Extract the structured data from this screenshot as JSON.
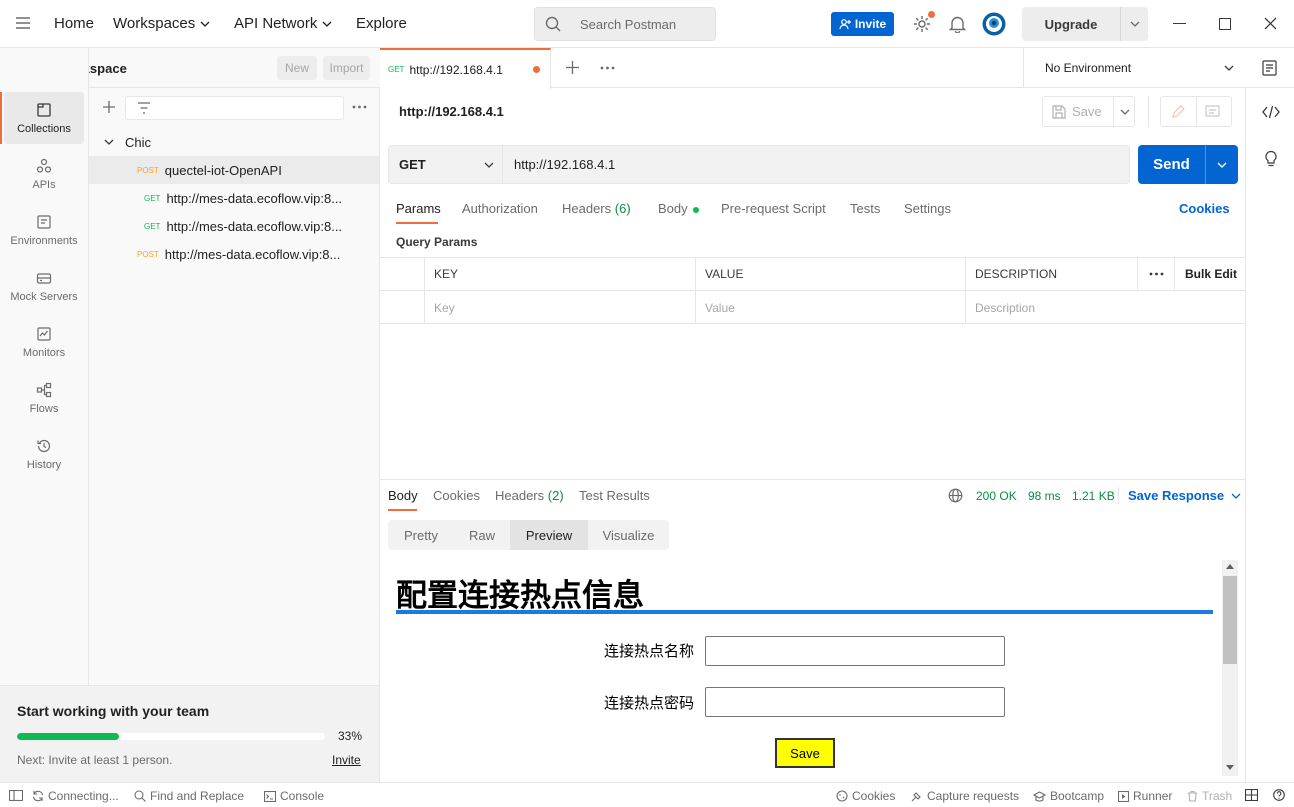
{
  "header": {
    "nav": [
      "Home",
      "Workspaces",
      "API Network",
      "Explore"
    ],
    "search_placeholder": "Search Postman",
    "invite_label": "Invite",
    "upgrade_label": "Upgrade"
  },
  "workspace": {
    "name": "My Workspace",
    "new_label": "New",
    "import_label": "Import"
  },
  "rail": [
    {
      "label": "Collections",
      "icon": "collections-icon"
    },
    {
      "label": "APIs",
      "icon": "apis-icon"
    },
    {
      "label": "Environments",
      "icon": "environments-icon"
    },
    {
      "label": "Mock Servers",
      "icon": "mock-servers-icon"
    },
    {
      "label": "Monitors",
      "icon": "monitors-icon"
    },
    {
      "label": "Flows",
      "icon": "flows-icon"
    },
    {
      "label": "History",
      "icon": "history-icon"
    }
  ],
  "collection": {
    "name": "Chic",
    "items": [
      {
        "method": "POST",
        "name": "quectel-iot-OpenAPI"
      },
      {
        "method": "GET",
        "name": "http://mes-data.ecoflow.vip:8..."
      },
      {
        "method": "GET",
        "name": "http://mes-data.ecoflow.vip:8..."
      },
      {
        "method": "POST",
        "name": "http://mes-data.ecoflow.vip:8..."
      }
    ]
  },
  "team_card": {
    "title": "Start working with your team",
    "progress_text": "33%",
    "progress_fraction": 0.33,
    "next_text": "Next: Invite at least 1 person.",
    "invite_link": "Invite",
    "color": "#0cbb52"
  },
  "tab": {
    "method": "GET",
    "title": "http://192.168.4.1",
    "environment": "No Environment"
  },
  "request": {
    "name": "http://192.168.4.1",
    "save_label": "Save",
    "method": "GET",
    "url": "http://192.168.4.1",
    "send_label": "Send",
    "tabs": [
      "Params",
      "Authorization",
      "Headers",
      "Body",
      "Pre-request Script",
      "Tests",
      "Settings"
    ],
    "headers_count": "(6)",
    "cookies_label": "Cookies",
    "query_params_label": "Query Params",
    "table": {
      "headers": [
        "KEY",
        "VALUE",
        "DESCRIPTION"
      ],
      "bulk_edit": "Bulk Edit",
      "placeholders": [
        "Key",
        "Value",
        "Description"
      ]
    }
  },
  "response": {
    "tabs": [
      "Body",
      "Cookies",
      "Headers",
      "Test Results"
    ],
    "headers_count": "(2)",
    "status": "200 OK",
    "time": "98 ms",
    "size": "1.21 KB",
    "save_response": "Save Response",
    "views": [
      "Pretty",
      "Raw",
      "Preview",
      "Visualize"
    ],
    "preview": {
      "heading": "配置连接热点信息",
      "label_ssid": "连接热点名称",
      "label_password": "连接热点密码",
      "save_button": "Save"
    }
  },
  "statusbar": {
    "left": [
      "Connecting...",
      "Find and Replace",
      "Console"
    ],
    "right": [
      "Cookies",
      "Capture requests",
      "Bootcamp",
      "Runner",
      "Trash"
    ]
  },
  "colors": {
    "accent_orange": "#f26b3a",
    "primary_blue": "#0265d2",
    "success_green": "#0cbb52"
  }
}
